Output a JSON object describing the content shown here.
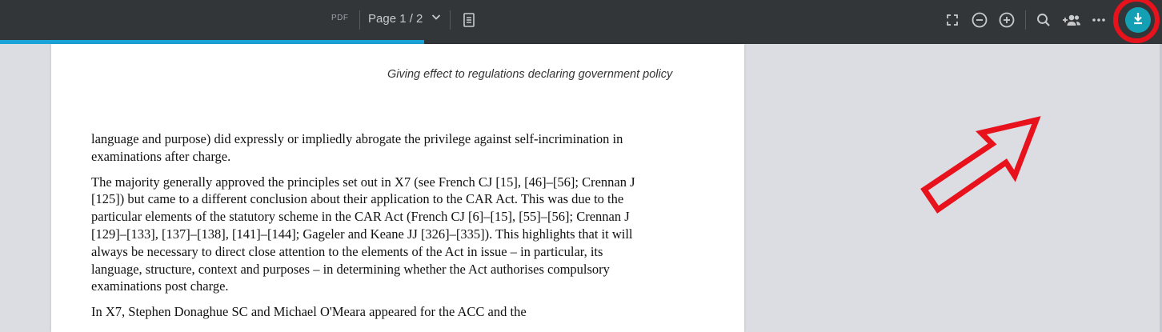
{
  "toolbar": {
    "format_label": "PDF",
    "page_indicator": "Page 1 / 2",
    "icons": {
      "page_menu": "chevron-down-icon",
      "thumbnails": "document-icon",
      "fullscreen": "fullscreen-icon",
      "zoom_out": "zoom-out-icon",
      "zoom_in": "zoom-in-icon",
      "search": "search-icon",
      "share": "add-people-icon",
      "more": "more-icon",
      "download": "download-icon"
    },
    "load_progress": 0.365
  },
  "document": {
    "running_head": "Giving effect to regulations declaring government policy",
    "paragraphs": [
      "language and purpose) did expressly or impliedly abrogate the privilege against self-incrimination in examinations after charge.",
      "The majority generally approved the principles set out in X7 (see French CJ [15], [46]–[56]; Crennan J [125]) but came to a different conclusion about their application to the CAR Act. This was due to the particular elements of the statutory scheme in the CAR Act (French CJ [6]–[15], [55]–[56]; Crennan J [129]–[133], [137]–[138], [141]–[144]; Gageler and Keane JJ [326]–[335]). This highlights that it will always be necessary to direct close attention to the elements of the Act in issue – in particular, its language, structure, context and purposes – in determining whether the Act authorises compulsory examinations post charge.",
      "In X7, Stephen Donaghue SC and Michael O'Meara appeared for the ACC and the"
    ]
  },
  "annotation": {
    "color": "#e8121d"
  }
}
